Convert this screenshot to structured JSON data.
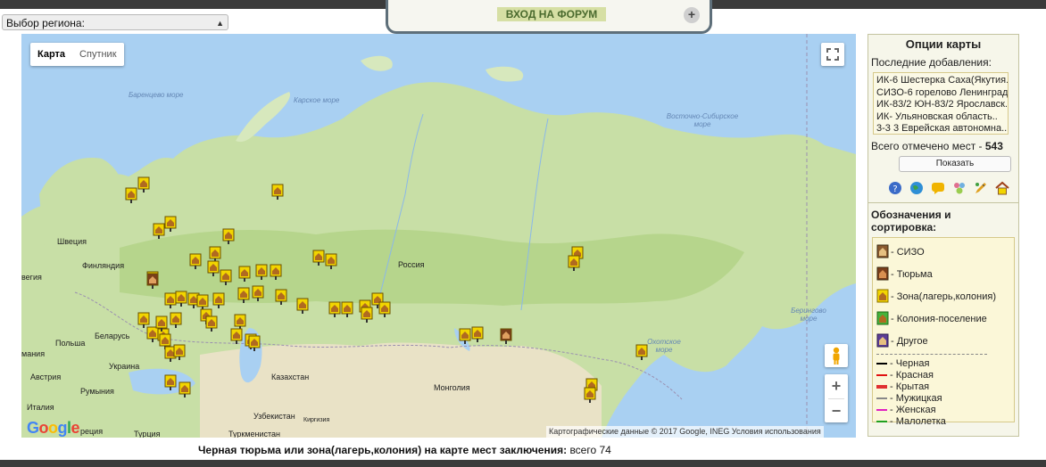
{
  "region_select": {
    "label": "Выбор региона:"
  },
  "forum": {
    "button_label": "ВХОД НА ФОРУМ",
    "plus_label": "+"
  },
  "map": {
    "type_buttons": [
      "Карта",
      "Спутник"
    ],
    "labels": {
      "barents_sea": "Баренцево море",
      "kara_sea": "Карское море",
      "east_siberian_sea": "Восточно-Сибирское море",
      "bering_sea": "Берингово море",
      "okhotsk_sea": "Охотское море",
      "sweden": "Швеция",
      "finland": "Финляндия",
      "norway": "вегия",
      "russia": "Россия",
      "poland": "Польша",
      "belarus": "Беларусь",
      "lithuania": "мания",
      "ukraine": "Украина",
      "austria": "Австрия",
      "romania": "Румыния",
      "italy": "Италия",
      "greece": "реция",
      "turkey": "Турция",
      "kazakhstan": "Казахстан",
      "mongolia": "Монголия",
      "uzbekistan": "Узбекистан",
      "kyrgyzstan": "Киргизия",
      "turkmenistan": "Туркменистан"
    },
    "google_logo": "Google",
    "attribution": "Картографические данные © 2017 Google, INEG Условия использования",
    "zoom_in": "+",
    "zoom_out": "−"
  },
  "caption": {
    "bold": "Черная тюрьма или зона(лагерь,колония) на карте мест заключения:",
    "rest": " всего 74"
  },
  "options": {
    "title": "Опции карты",
    "recent_label": "Последние добавления:",
    "recent_items": [
      "ИК-6 Шестерка Саха(Якутия..",
      "СИЗО-6 горелово Ленинград..",
      "ИК-83/2 ЮН-83/2 Ярославск..",
      "ИК- Ульяновская область..",
      "3-3 3 Еврейская автономна.."
    ],
    "total_label": "Всего отмечено мест - ",
    "total_value": "543",
    "show_button": "Показать",
    "legend_title": "Обозначения и сортировка:",
    "legend_items": [
      {
        "label": "- СИЗО",
        "color": "#8a5a2e"
      },
      {
        "label": "- Тюрьма",
        "color": "#7a3e1a"
      },
      {
        "label": "- Зона(лагерь,колония)",
        "color": "#f2d500"
      },
      {
        "label": "- Колония-поселение",
        "color": "#45b33a"
      },
      {
        "label": "- Другое",
        "color": "#5c3d96"
      }
    ],
    "line_legend": [
      {
        "label": "- Черная",
        "color": "#000000"
      },
      {
        "label": "- Красная",
        "color": "#e01010"
      },
      {
        "label": "- Крытая",
        "color": "#e03030"
      },
      {
        "label": "- Мужицкая",
        "color": "#888888"
      },
      {
        "label": "- Женская",
        "color": "#e020c0"
      },
      {
        "label": "- Малолетка",
        "color": "#20a020"
      }
    ]
  }
}
